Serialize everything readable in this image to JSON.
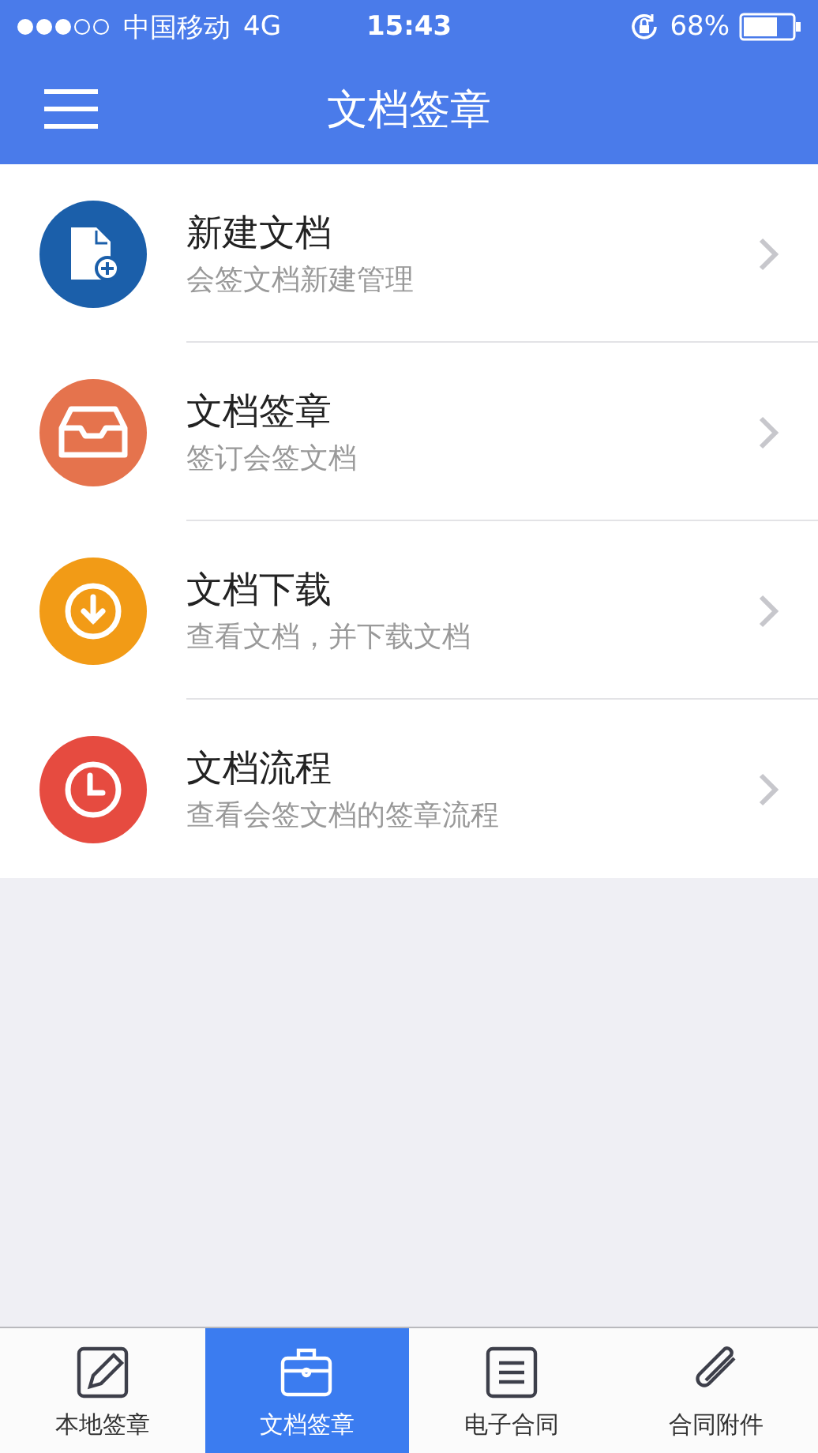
{
  "status_bar": {
    "carrier": "中国移动",
    "network": "4G",
    "time": "15:43",
    "battery": "68%"
  },
  "header": {
    "title": "文档签章"
  },
  "menu_items": [
    {
      "kind": "document-add",
      "color": "#1b5faa",
      "title": "新建文档",
      "subtitle": "会签文档新建管理"
    },
    {
      "kind": "inbox",
      "color": "#e5734d",
      "title": "文档签章",
      "subtitle": "签订会签文档"
    },
    {
      "kind": "download",
      "color": "#f29b16",
      "title": "文档下载",
      "subtitle": "查看文档，并下载文档"
    },
    {
      "kind": "clock",
      "color": "#e64b40",
      "title": "文档流程",
      "subtitle": "查看会签文档的签章流程"
    }
  ],
  "tab_bar": [
    {
      "kind": "edit",
      "label": "本地签章",
      "selected": false
    },
    {
      "kind": "briefcase",
      "label": "文档签章",
      "selected": true
    },
    {
      "kind": "list",
      "label": "电子合同",
      "selected": false
    },
    {
      "kind": "clip",
      "label": "合同附件",
      "selected": false
    }
  ]
}
